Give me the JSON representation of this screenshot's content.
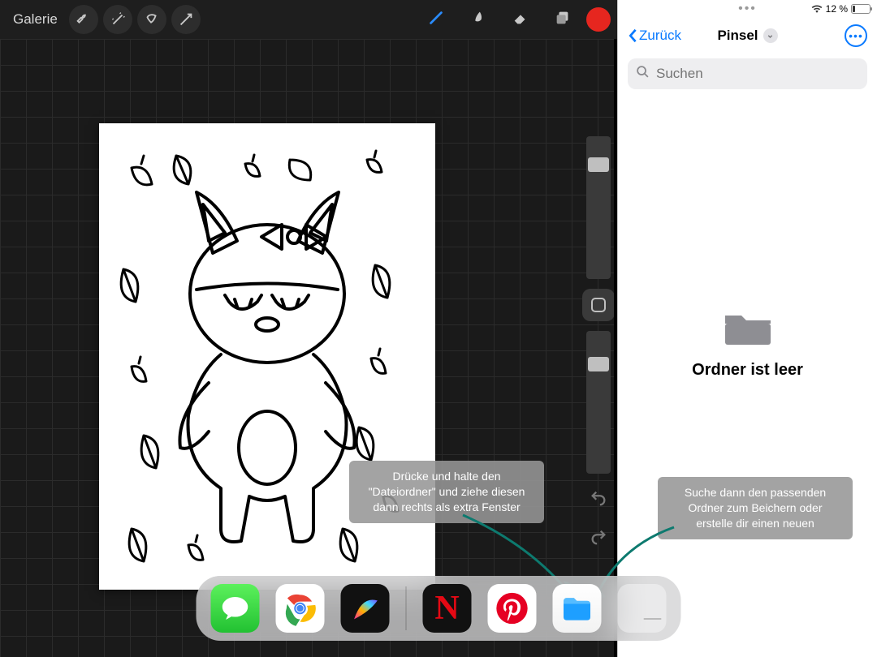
{
  "procreate": {
    "gallery_label": "Galerie",
    "color_swatch": "#e6261f"
  },
  "hints": {
    "left": "Drücke und halte den \"Dateiordner\" und ziehe diesen dann rechts als extra Fenster",
    "right": "Suche dann den passenden Ordner zum Beichern oder erstelle dir einen neuen"
  },
  "files": {
    "back_label": "Zurück",
    "title": "Pinsel",
    "search_placeholder": "Suchen",
    "empty_message": "Ordner ist leer"
  },
  "status": {
    "battery_text": "12 %"
  },
  "dock": {
    "apps_left": [
      "messages",
      "chrome",
      "procreate"
    ],
    "apps_right": [
      "netflix",
      "pinterest",
      "files",
      "folder"
    ]
  }
}
